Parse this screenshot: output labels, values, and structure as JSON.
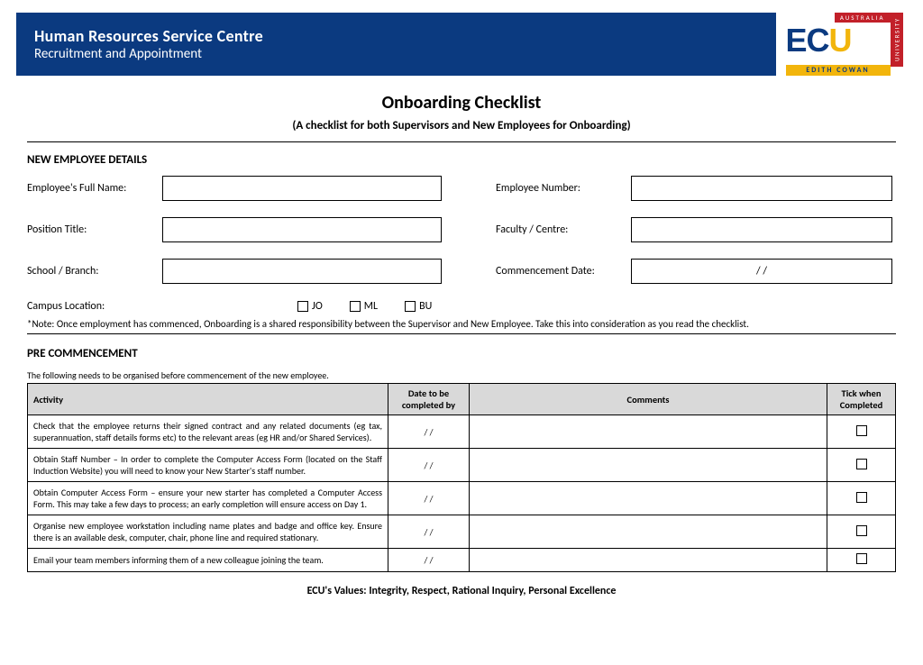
{
  "banner": {
    "line1": "Human Resources Service Centre",
    "line2": "Recruitment and Appointment",
    "logo": {
      "top_bar": "AUSTRALIA",
      "main": "ECU",
      "side": "UNIVERSITY",
      "bottom": "EDITH COWAN"
    }
  },
  "title": "Onboarding Checklist",
  "subtitle": "(A checklist for both Supervisors and New Employees for Onboarding)",
  "section_employee": "NEW EMPLOYEE DETAILS",
  "fields": {
    "full_name_label": "Employee's Full Name:",
    "employee_number_label": "Employee Number:",
    "position_title_label": "Position Title:",
    "faculty_centre_label": "Faculty / Centre:",
    "school_branch_label": "School / Branch:",
    "commencement_label": "Commencement Date:",
    "commencement_value": "/               /",
    "campus_label": "Campus Location:",
    "campus_options": {
      "jo": "JO",
      "ml": "ML",
      "bu": "BU"
    }
  },
  "note": "*Note: Once employment has commenced, Onboarding is a shared responsibility between the Supervisor and New Employee. Take this into consideration as you read the checklist.",
  "section_pre": "PRE COMMENCEMENT",
  "pre_intro": "The following needs to be organised before commencement of the new employee.",
  "table": {
    "headers": {
      "activity": "Activity",
      "date": "Date to be completed by",
      "comments": "Comments",
      "tick": "Tick when Completed"
    },
    "rows": [
      {
        "activity": "Check that the employee returns their signed contract and any related documents (eg tax, superannuation, staff details forms etc) to the relevant areas (eg HR and/or Shared Services).",
        "date": "/     /"
      },
      {
        "activity": "Obtain Staff Number – In order to complete the Computer Access Form (located on the Staff Induction Website) you will need to know your New Starter's staff number.",
        "date": "/     /"
      },
      {
        "activity": "Obtain Computer Access Form – ensure your new starter has completed a Computer Access Form. This may take a few days to process; an early completion will ensure access on Day 1.",
        "date": "/     /"
      },
      {
        "activity": "Organise new employee workstation including name plates and badge and office key. Ensure there is an available desk, computer, chair, phone line and required stationary.",
        "date": "/     /"
      },
      {
        "activity": "Email your team members informing them of a new colleague joining the team.",
        "date": "/     /"
      }
    ]
  },
  "footer": "ECU's Values: Integrity, Respect, Rational Inquiry, Personal Excellence"
}
